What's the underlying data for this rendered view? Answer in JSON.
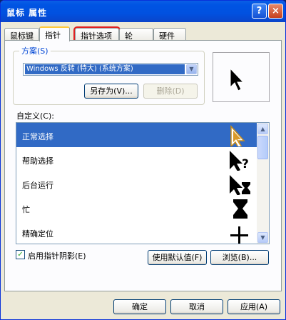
{
  "window": {
    "title": "鼠标 属性"
  },
  "titlebar": {
    "help": "?",
    "close": "×"
  },
  "tabs": [
    {
      "label": "鼠标键"
    },
    {
      "label": "指针"
    },
    {
      "label": "指针选项"
    },
    {
      "label": "轮"
    },
    {
      "label": "硬件"
    }
  ],
  "scheme": {
    "legend": "方案(S)",
    "value": "Windows 反转 (特大) (系统方案)",
    "save_as_button": "另存为(V)...",
    "delete_button": "删除(D)"
  },
  "customize": {
    "label": "自定义(C):",
    "items": [
      {
        "label": "正常选择",
        "icon": "arrow-cursor-icon"
      },
      {
        "label": "帮助选择",
        "icon": "help-cursor-icon"
      },
      {
        "label": "后台运行",
        "icon": "working-cursor-icon"
      },
      {
        "label": "忙",
        "icon": "hourglass-cursor-icon"
      },
      {
        "label": "精确定位",
        "icon": "crosshair-cursor-icon"
      }
    ]
  },
  "shadow": {
    "label": "启用指针阴影(E)",
    "checked": true
  },
  "buttons": {
    "use_default": "使用默认值(F)",
    "browse": "浏览(B)...",
    "ok": "确定",
    "cancel": "取消",
    "apply": "应用(A)"
  }
}
